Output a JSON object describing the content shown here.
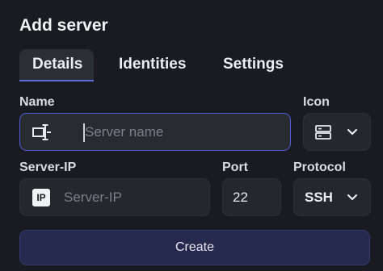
{
  "dialog": {
    "title": "Add server"
  },
  "tabs": [
    {
      "label": "Details",
      "active": true
    },
    {
      "label": "Identities",
      "active": false
    },
    {
      "label": "Settings",
      "active": false
    }
  ],
  "form": {
    "name": {
      "label": "Name",
      "placeholder": "Server name",
      "value": "",
      "icon": "server-name-icon"
    },
    "icon": {
      "label": "Icon",
      "value_icon": "server-rack-icon",
      "dropdown_icon": "chevron-down-icon"
    },
    "server_ip": {
      "label": "Server-IP",
      "placeholder": "Server-IP",
      "value": "",
      "icon": "ip-icon",
      "icon_text": "IP"
    },
    "port": {
      "label": "Port",
      "value": "22"
    },
    "protocol": {
      "label": "Protocol",
      "value": "SSH",
      "dropdown_icon": "chevron-down-icon"
    }
  },
  "actions": {
    "create_label": "Create"
  },
  "colors": {
    "accent": "#4b5bd6",
    "background": "#1a1b20",
    "field": "#26272d",
    "button": "#262a4e"
  }
}
